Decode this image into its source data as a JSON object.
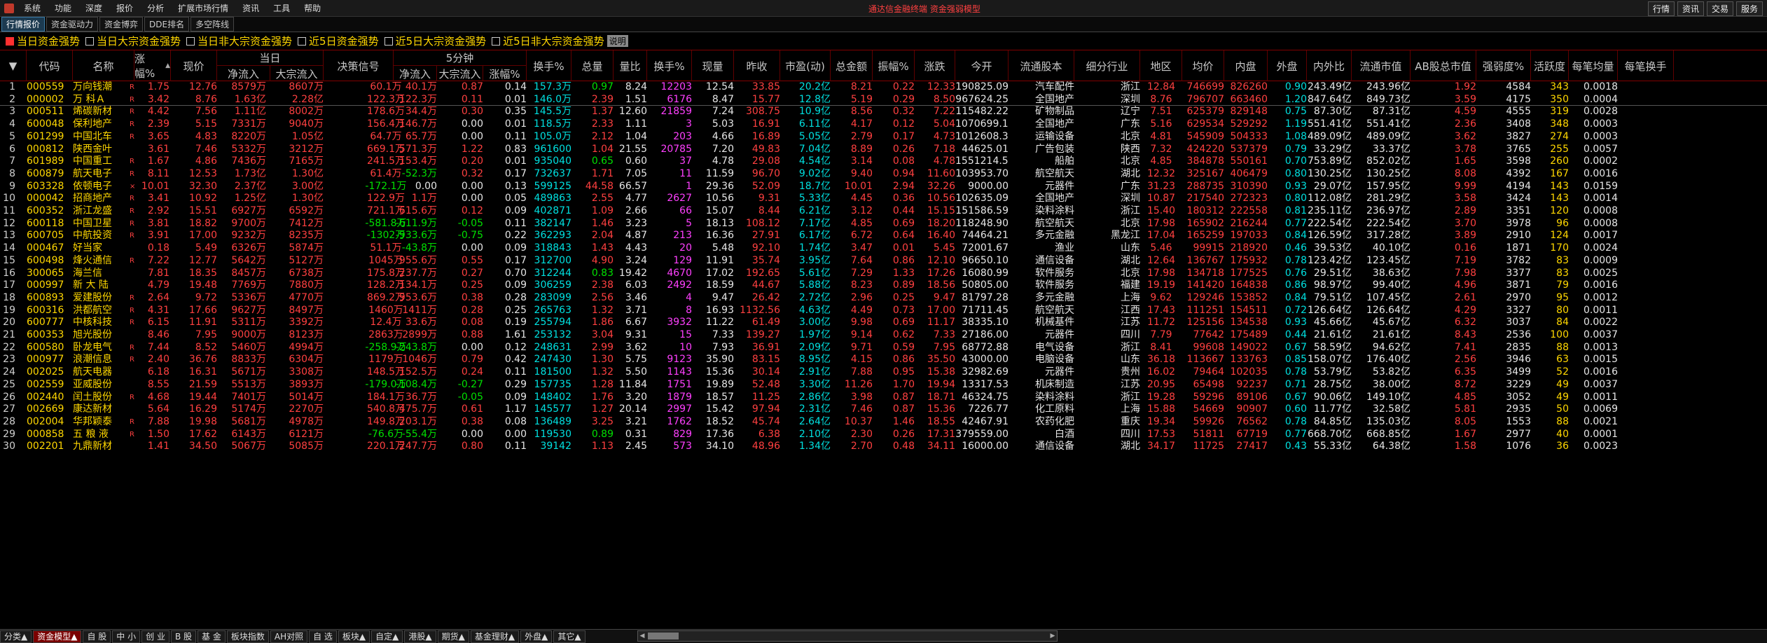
{
  "menubar": {
    "items": [
      "系统",
      "功能",
      "深度",
      "报价",
      "分析",
      "扩展市场行情",
      "资讯",
      "工具",
      "帮助"
    ],
    "title": "通达信金融终端  资金强弱模型",
    "right_buttons": [
      "行情",
      "资讯",
      "交易",
      "服务"
    ]
  },
  "subtabs": [
    "行情报价",
    "资金驱动力",
    "资金博弈",
    "DDE排名",
    "多空阵线"
  ],
  "filters": [
    {
      "label": "当日资金强势",
      "checked": true
    },
    {
      "label": "当日大宗资金强势",
      "checked": false
    },
    {
      "label": "当日非大宗资金强势",
      "checked": false
    },
    {
      "label": "近5日资金强势",
      "checked": false
    },
    {
      "label": "近5日大宗资金强势",
      "checked": false
    },
    {
      "label": "近5日非大宗资金强势",
      "checked": false
    }
  ],
  "filter_desc": "说明",
  "header": {
    "sort_icon": "▼",
    "cols": [
      "代码",
      "名称",
      "涨幅%",
      "现价",
      "决策信号",
      "换手%",
      "总量",
      "量比",
      "换手%",
      "现量",
      "昨收",
      "市盈(动)",
      "总金额",
      "振幅%",
      "涨跌",
      "今开",
      "流通股本",
      "细分行业",
      "地区",
      "均价",
      "内盘",
      "外盘",
      "内外比",
      "流通市值",
      "AB股总市值",
      "强弱度%",
      "活跃度",
      "每笔均量",
      "每笔换手"
    ],
    "group_day": "当日",
    "group_5min": "5分钟",
    "sub_day": [
      "净流入",
      "大宗流入"
    ],
    "sub_5min": [
      "净流入",
      "大宗流入",
      "涨幅%"
    ]
  },
  "rows": [
    [
      "1",
      "000559",
      "万向钱潮",
      "R",
      "1.75",
      "12.76",
      "8579万",
      "8607万",
      "60.1万",
      "40.1万",
      "0.87",
      "0.14",
      "157.3万",
      "0.97",
      "8.24",
      "12203",
      "12.54",
      "33.85",
      "20.2亿",
      "8.21",
      "0.22",
      "12.33",
      "190825.09",
      "汽车配件",
      "浙江",
      "12.84",
      "746699",
      "826260",
      "0.90",
      "243.49亿",
      "243.96亿",
      "1.92",
      "4584",
      "343",
      "0.0018"
    ],
    [
      "2",
      "000002",
      "万  科Ａ",
      "R",
      "3.42",
      "8.76",
      "1.63亿",
      "2.28亿",
      "122.3万",
      "122.3万",
      "0.11",
      "0.01",
      "146.0万",
      "2.39",
      "1.51",
      "6176",
      "8.47",
      "15.77",
      "12.8亿",
      "5.19",
      "0.29",
      "8.50",
      "967624.25",
      "全国地产",
      "深圳",
      "8.76",
      "796707",
      "663460",
      "1.20",
      "847.64亿",
      "849.73亿",
      "3.59",
      "4175",
      "350",
      "0.0004"
    ],
    [
      "3",
      "000511",
      "烯碳新材",
      "R",
      "4.42",
      "7.56",
      "1.11亿",
      "8002万",
      "178.6万",
      "34.4万",
      "0.30",
      "0.35",
      "145.5万",
      "1.37",
      "12.60",
      "21859",
      "7.24",
      "308.75",
      "10.9亿",
      "8.56",
      "0.32",
      "7.22",
      "115482.22",
      "矿物制品",
      "辽宁",
      "7.51",
      "625379",
      "829148",
      "0.75",
      "87.30亿",
      "87.31亿",
      "4.59",
      "4555",
      "319",
      "0.0028"
    ],
    [
      "4",
      "600048",
      "保利地产",
      "R",
      "2.39",
      "5.15",
      "7331万",
      "9040万",
      "156.4万",
      "146.7万",
      "0.00",
      "0.01",
      "118.5万",
      "2.33",
      "1.11",
      "3",
      "5.03",
      "16.91",
      "6.11亿",
      "4.17",
      "0.12",
      "5.04",
      "1070699.13",
      "全国地产",
      "广东",
      "5.16",
      "629534",
      "529292",
      "1.19",
      "551.41亿",
      "551.41亿",
      "2.36",
      "3408",
      "348",
      "0.0003"
    ],
    [
      "5",
      "601299",
      "中国北车",
      "R",
      "3.65",
      "4.83",
      "8220万",
      "1.05亿",
      "64.7万",
      "65.7万",
      "0.00",
      "0.11",
      "105.0万",
      "2.12",
      "1.04",
      "203",
      "4.66",
      "16.89",
      "5.05亿",
      "2.79",
      "0.17",
      "4.73",
      "1012608.38",
      "运输设备",
      "北京",
      "4.81",
      "545909",
      "504333",
      "1.08",
      "489.09亿",
      "489.09亿",
      "3.62",
      "3827",
      "274",
      "0.0003"
    ],
    [
      "6",
      "000812",
      "陕西金叶",
      "",
      "3.61",
      "7.46",
      "5332万",
      "3212万",
      "669.1万",
      "571.3万",
      "1.22",
      "0.83",
      "961600",
      "1.04",
      "21.55",
      "20785",
      "7.20",
      "49.83",
      "7.04亿",
      "8.89",
      "0.26",
      "7.18",
      "44625.01",
      "广告包装",
      "陕西",
      "7.32",
      "424220",
      "537379",
      "0.79",
      "33.29亿",
      "33.37亿",
      "3.78",
      "3765",
      "255",
      "0.0057"
    ],
    [
      "7",
      "601989",
      "中国重工",
      "R",
      "1.67",
      "4.86",
      "7436万",
      "7165万",
      "241.5万",
      "153.4万",
      "0.20",
      "0.01",
      "935040",
      "0.65",
      "0.60",
      "37",
      "4.78",
      "29.08",
      "4.54亿",
      "3.14",
      "0.08",
      "4.78",
      "1551214.50",
      "船舶",
      "北京",
      "4.85",
      "384878",
      "550161",
      "0.70",
      "753.89亿",
      "852.02亿",
      "1.65",
      "3598",
      "260",
      "0.0002"
    ],
    [
      "8",
      "600879",
      "航天电子",
      "R",
      "8.11",
      "12.53",
      "1.73亿",
      "1.30亿",
      "61.4万",
      "-52.3万",
      "0.32",
      "0.17",
      "732637",
      "1.71",
      "7.05",
      "11",
      "11.59",
      "96.70",
      "9.02亿",
      "9.40",
      "0.94",
      "11.60",
      "103953.70",
      "航空航天",
      "湖北",
      "12.32",
      "325167",
      "406479",
      "0.80",
      "130.25亿",
      "130.25亿",
      "8.08",
      "4392",
      "167",
      "0.0016"
    ],
    [
      "9",
      "603328",
      "依顿电子",
      "×",
      "10.01",
      "32.30",
      "2.37亿",
      "3.00亿",
      "-172.1万",
      "0.00",
      "0.00",
      "0.13",
      "599125",
      "44.58",
      "66.57",
      "1",
      "29.36",
      "52.09",
      "18.7亿",
      "10.01",
      "2.94",
      "32.26",
      "9000.00",
      "元器件",
      "广东",
      "31.23",
      "288735",
      "310390",
      "0.93",
      "29.07亿",
      "157.95亿",
      "9.99",
      "4194",
      "143",
      "0.0159"
    ],
    [
      "10",
      "000042",
      "招商地产",
      "R",
      "3.41",
      "10.92",
      "1.25亿",
      "1.30亿",
      "122.9万",
      "1.1万",
      "0.00",
      "0.05",
      "489863",
      "2.55",
      "4.77",
      "2627",
      "10.56",
      "9.31",
      "5.33亿",
      "4.45",
      "0.36",
      "10.56",
      "102635.09",
      "全国地产",
      "深圳",
      "10.87",
      "217540",
      "272323",
      "0.80",
      "112.08亿",
      "281.29亿",
      "3.58",
      "3424",
      "143",
      "0.0014"
    ],
    [
      "11",
      "600352",
      "浙江龙盛",
      "R",
      "2.92",
      "15.51",
      "6927万",
      "6592万",
      "721.1万",
      "615.6万",
      "0.12",
      "0.09",
      "402871",
      "1.09",
      "2.66",
      "66",
      "15.07",
      "8.44",
      "6.21亿",
      "3.12",
      "0.44",
      "15.15",
      "151586.59",
      "染料涂料",
      "浙江",
      "15.40",
      "180312",
      "222558",
      "0.81",
      "235.11亿",
      "236.97亿",
      "2.89",
      "3351",
      "120",
      "0.0008"
    ],
    [
      "12",
      "600118",
      "中国卫星",
      "R",
      "3.81",
      "18.82",
      "9700万",
      "7412万",
      "-581.8万",
      "-611.9万",
      "-0.05",
      "0.11",
      "382147",
      "1.46",
      "3.23",
      "5",
      "18.13",
      "108.12",
      "7.17亿",
      "4.85",
      "0.69",
      "18.20",
      "118248.90",
      "航空航天",
      "北京",
      "17.98",
      "165902",
      "216244",
      "0.77",
      "222.54亿",
      "222.54亿",
      "3.70",
      "3978",
      "96",
      "0.0008"
    ],
    [
      "13",
      "600705",
      "中航投资",
      "R",
      "3.91",
      "17.00",
      "9232万",
      "8235万",
      "-1302万",
      "-933.6万",
      "-0.75",
      "0.22",
      "362293",
      "2.04",
      "4.87",
      "213",
      "16.36",
      "27.91",
      "6.17亿",
      "6.72",
      "0.64",
      "16.40",
      "74464.21",
      "多元金融",
      "黑龙江",
      "17.04",
      "165259",
      "197033",
      "0.84",
      "126.59亿",
      "317.28亿",
      "3.89",
      "2910",
      "124",
      "0.0017"
    ],
    [
      "14",
      "000467",
      "好当家",
      "",
      "0.18",
      "5.49",
      "6326万",
      "5874万",
      "51.1万",
      "-43.8万",
      "0.00",
      "0.09",
      "318843",
      "1.43",
      "4.43",
      "20",
      "5.48",
      "92.10",
      "1.74亿",
      "3.47",
      "0.01",
      "5.45",
      "72001.67",
      "渔业",
      "山东",
      "5.46",
      "99915",
      "218920",
      "0.46",
      "39.53亿",
      "40.10亿",
      "0.16",
      "1871",
      "170",
      "0.0024"
    ],
    [
      "15",
      "600498",
      "烽火通信",
      "R",
      "7.22",
      "12.77",
      "5642万",
      "5127万",
      "1045万",
      "955.6万",
      "0.55",
      "0.17",
      "312700",
      "4.90",
      "3.24",
      "129",
      "11.91",
      "35.74",
      "3.95亿",
      "7.64",
      "0.86",
      "12.10",
      "96650.10",
      "通信设备",
      "湖北",
      "12.64",
      "136767",
      "175932",
      "0.78",
      "123.42亿",
      "123.45亿",
      "7.19",
      "3782",
      "83",
      "0.0009"
    ],
    [
      "16",
      "300065",
      "海兰信",
      "",
      "7.81",
      "18.35",
      "8457万",
      "6738万",
      "175.8万",
      "237.7万",
      "0.27",
      "0.70",
      "312244",
      "0.83",
      "19.42",
      "4670",
      "17.02",
      "192.65",
      "5.61亿",
      "7.29",
      "1.33",
      "17.26",
      "16080.99",
      "软件服务",
      "北京",
      "17.98",
      "134718",
      "177525",
      "0.76",
      "29.51亿",
      "38.63亿",
      "7.98",
      "3377",
      "83",
      "0.0025"
    ],
    [
      "17",
      "000997",
      "新 大 陆",
      "",
      "4.79",
      "19.48",
      "7769万",
      "7880万",
      "128.2万",
      "134.1万",
      "0.25",
      "0.09",
      "306259",
      "2.38",
      "6.03",
      "2492",
      "18.59",
      "44.67",
      "5.88亿",
      "8.23",
      "0.89",
      "18.56",
      "50805.00",
      "软件服务",
      "福建",
      "19.19",
      "141420",
      "164838",
      "0.86",
      "98.97亿",
      "99.40亿",
      "4.96",
      "3871",
      "79",
      "0.0016"
    ],
    [
      "18",
      "600893",
      "爱建股份",
      "R",
      "2.64",
      "9.72",
      "5336万",
      "4770万",
      "869.2万",
      "953.6万",
      "0.38",
      "0.28",
      "283099",
      "2.56",
      "3.46",
      "4",
      "9.47",
      "26.42",
      "2.72亿",
      "2.96",
      "0.25",
      "9.47",
      "81797.28",
      "多元金融",
      "上海",
      "9.62",
      "129246",
      "153852",
      "0.84",
      "79.51亿",
      "107.45亿",
      "2.61",
      "2970",
      "95",
      "0.0012"
    ],
    [
      "19",
      "600316",
      "洪都航空",
      "R",
      "4.31",
      "17.66",
      "9627万",
      "8497万",
      "1460万",
      "1411万",
      "0.28",
      "0.25",
      "265763",
      "1.32",
      "3.71",
      "8",
      "16.93",
      "1132.56",
      "4.63亿",
      "4.49",
      "0.73",
      "17.00",
      "71711.45",
      "航空航天",
      "江西",
      "17.43",
      "111251",
      "154511",
      "0.72",
      "126.64亿",
      "126.64亿",
      "4.29",
      "3327",
      "80",
      "0.0011"
    ],
    [
      "20",
      "600777",
      "中核科技",
      "R",
      "6.15",
      "11.91",
      "5311万",
      "3392万",
      "12.4万",
      "33.6万",
      "0.08",
      "0.19",
      "255794",
      "1.86",
      "6.67",
      "3932",
      "11.22",
      "61.49",
      "3.00亿",
      "9.98",
      "0.69",
      "11.17",
      "38335.10",
      "机械基件",
      "江苏",
      "11.72",
      "125156",
      "134538",
      "0.93",
      "45.66亿",
      "45.67亿",
      "6.32",
      "3037",
      "84",
      "0.0022"
    ],
    [
      "21",
      "600353",
      "旭光股份",
      "",
      "8.46",
      "7.95",
      "9000万",
      "8123万",
      "2863万",
      "2899万",
      "0.88",
      "1.61",
      "253132",
      "3.04",
      "9.31",
      "15",
      "7.33",
      "139.27",
      "1.97亿",
      "9.14",
      "0.62",
      "7.33",
      "27186.00",
      "元器件",
      "四川",
      "7.79",
      "77642",
      "175489",
      "0.44",
      "21.61亿",
      "21.61亿",
      "8.43",
      "2536",
      "100",
      "0.0037"
    ],
    [
      "22",
      "600580",
      "卧龙电气",
      "R",
      "7.44",
      "8.52",
      "5460万",
      "4994万",
      "-258.9万",
      "-243.8万",
      "0.00",
      "0.12",
      "248631",
      "2.99",
      "3.62",
      "10",
      "7.93",
      "36.91",
      "2.09亿",
      "9.71",
      "0.59",
      "7.95",
      "68772.88",
      "电气设备",
      "浙江",
      "8.41",
      "99608",
      "149022",
      "0.67",
      "58.59亿",
      "94.62亿",
      "7.41",
      "2835",
      "88",
      "0.0013"
    ],
    [
      "23",
      "000977",
      "浪潮信息",
      "R",
      "2.40",
      "36.76",
      "8833万",
      "6304万",
      "1179万",
      "1046万",
      "0.79",
      "0.42",
      "247430",
      "1.30",
      "5.75",
      "9123",
      "35.90",
      "83.15",
      "8.95亿",
      "4.15",
      "0.86",
      "35.50",
      "43000.00",
      "电脑设备",
      "山东",
      "36.18",
      "113667",
      "133763",
      "0.85",
      "158.07亿",
      "176.40亿",
      "2.56",
      "3946",
      "63",
      "0.0015"
    ],
    [
      "24",
      "002025",
      "航天电器",
      "",
      "6.18",
      "16.31",
      "5671万",
      "3308万",
      "148.5万",
      "152.5万",
      "0.24",
      "0.11",
      "181500",
      "1.32",
      "5.50",
      "1143",
      "15.36",
      "30.14",
      "2.91亿",
      "7.88",
      "0.95",
      "15.38",
      "32982.69",
      "元器件",
      "贵州",
      "16.02",
      "79464",
      "102035",
      "0.78",
      "53.79亿",
      "53.82亿",
      "6.35",
      "3499",
      "52",
      "0.0016"
    ],
    [
      "25",
      "002559",
      "亚威股份",
      "",
      "8.55",
      "21.59",
      "5513万",
      "3893万",
      "-179.0万",
      "-108.4万",
      "-0.27",
      "0.29",
      "157735",
      "1.28",
      "11.84",
      "1751",
      "19.89",
      "52.48",
      "3.30亿",
      "11.26",
      "1.70",
      "19.94",
      "13317.53",
      "机床制造",
      "江苏",
      "20.95",
      "65498",
      "92237",
      "0.71",
      "28.75亿",
      "38.00亿",
      "8.72",
      "3229",
      "49",
      "0.0037"
    ],
    [
      "26",
      "002440",
      "闰土股份",
      "R",
      "4.68",
      "19.44",
      "7401万",
      "5014万",
      "184.1万",
      "36.7万",
      "-0.05",
      "0.09",
      "148402",
      "1.76",
      "3.20",
      "1879",
      "18.57",
      "11.25",
      "2.86亿",
      "3.98",
      "0.87",
      "18.71",
      "46324.75",
      "染料涂料",
      "浙江",
      "19.28",
      "59296",
      "89106",
      "0.67",
      "90.06亿",
      "149.10亿",
      "4.85",
      "3052",
      "49",
      "0.0011"
    ],
    [
      "27",
      "002669",
      "康达新材",
      "",
      "5.64",
      "16.29",
      "5174万",
      "2270万",
      "540.8万",
      "475.7万",
      "0.61",
      "1.17",
      "145577",
      "1.27",
      "20.14",
      "2997",
      "15.42",
      "97.94",
      "2.31亿",
      "7.46",
      "0.87",
      "15.36",
      "7226.77",
      "化工原料",
      "上海",
      "15.88",
      "54669",
      "90907",
      "0.60",
      "11.77亿",
      "32.58亿",
      "5.81",
      "2935",
      "50",
      "0.0069"
    ],
    [
      "28",
      "002004",
      "华邦颖泰",
      "R",
      "7.88",
      "19.98",
      "5681万",
      "4978万",
      "149.8万",
      "203.1万",
      "0.38",
      "0.08",
      "136489",
      "3.25",
      "3.21",
      "1762",
      "18.52",
      "45.74",
      "2.64亿",
      "10.37",
      "1.46",
      "18.55",
      "42467.91",
      "农药化肥",
      "重庆",
      "19.34",
      "59926",
      "76562",
      "0.78",
      "84.85亿",
      "135.03亿",
      "8.05",
      "1553",
      "88",
      "0.0021"
    ],
    [
      "29",
      "000858",
      "五 粮 液",
      "R",
      "1.50",
      "17.62",
      "6143万",
      "6121万",
      "-76.6万",
      "-55.4万",
      "0.00",
      "0.00",
      "119530",
      "0.89",
      "0.31",
      "829",
      "17.36",
      "6.38",
      "2.10亿",
      "2.30",
      "0.26",
      "17.31",
      "379559.00",
      "白酒",
      "四川",
      "17.53",
      "51811",
      "67719",
      "0.77",
      "668.70亿",
      "668.85亿",
      "1.67",
      "2977",
      "40",
      "0.0001"
    ],
    [
      "30",
      "002201",
      "九鼎新材",
      "",
      "1.41",
      "34.50",
      "5067万",
      "5085万",
      "220.1万",
      "247.7万",
      "0.80",
      "0.11",
      "39142",
      "1.13",
      "2.45",
      "573",
      "34.10",
      "48.96",
      "1.34亿",
      "2.70",
      "0.48",
      "34.11",
      "16000.00",
      "通信设备",
      "湖北",
      "34.17",
      "11725",
      "27417",
      "0.43",
      "55.33亿",
      "64.38亿",
      "1.58",
      "1076",
      "36",
      "0.0023"
    ]
  ],
  "bottom_tabs": [
    "分类▲",
    "资金模型▲",
    "自 股",
    "中 小",
    "创 业",
    "B 股",
    "基 金",
    "板块指数",
    "AH对照",
    "自 选",
    "板块▲",
    "自定▲",
    "港股▲",
    "期货▲",
    "基金理财▲",
    "外盘▲",
    "其它▲"
  ],
  "colors": {
    "up": "#ff4040",
    "down": "#00e000",
    "flat": "#e6e6e6",
    "code": "#ffd700",
    "name": "#ffd700",
    "accent": "#00e0e0",
    "volume": "#ff40ff"
  }
}
